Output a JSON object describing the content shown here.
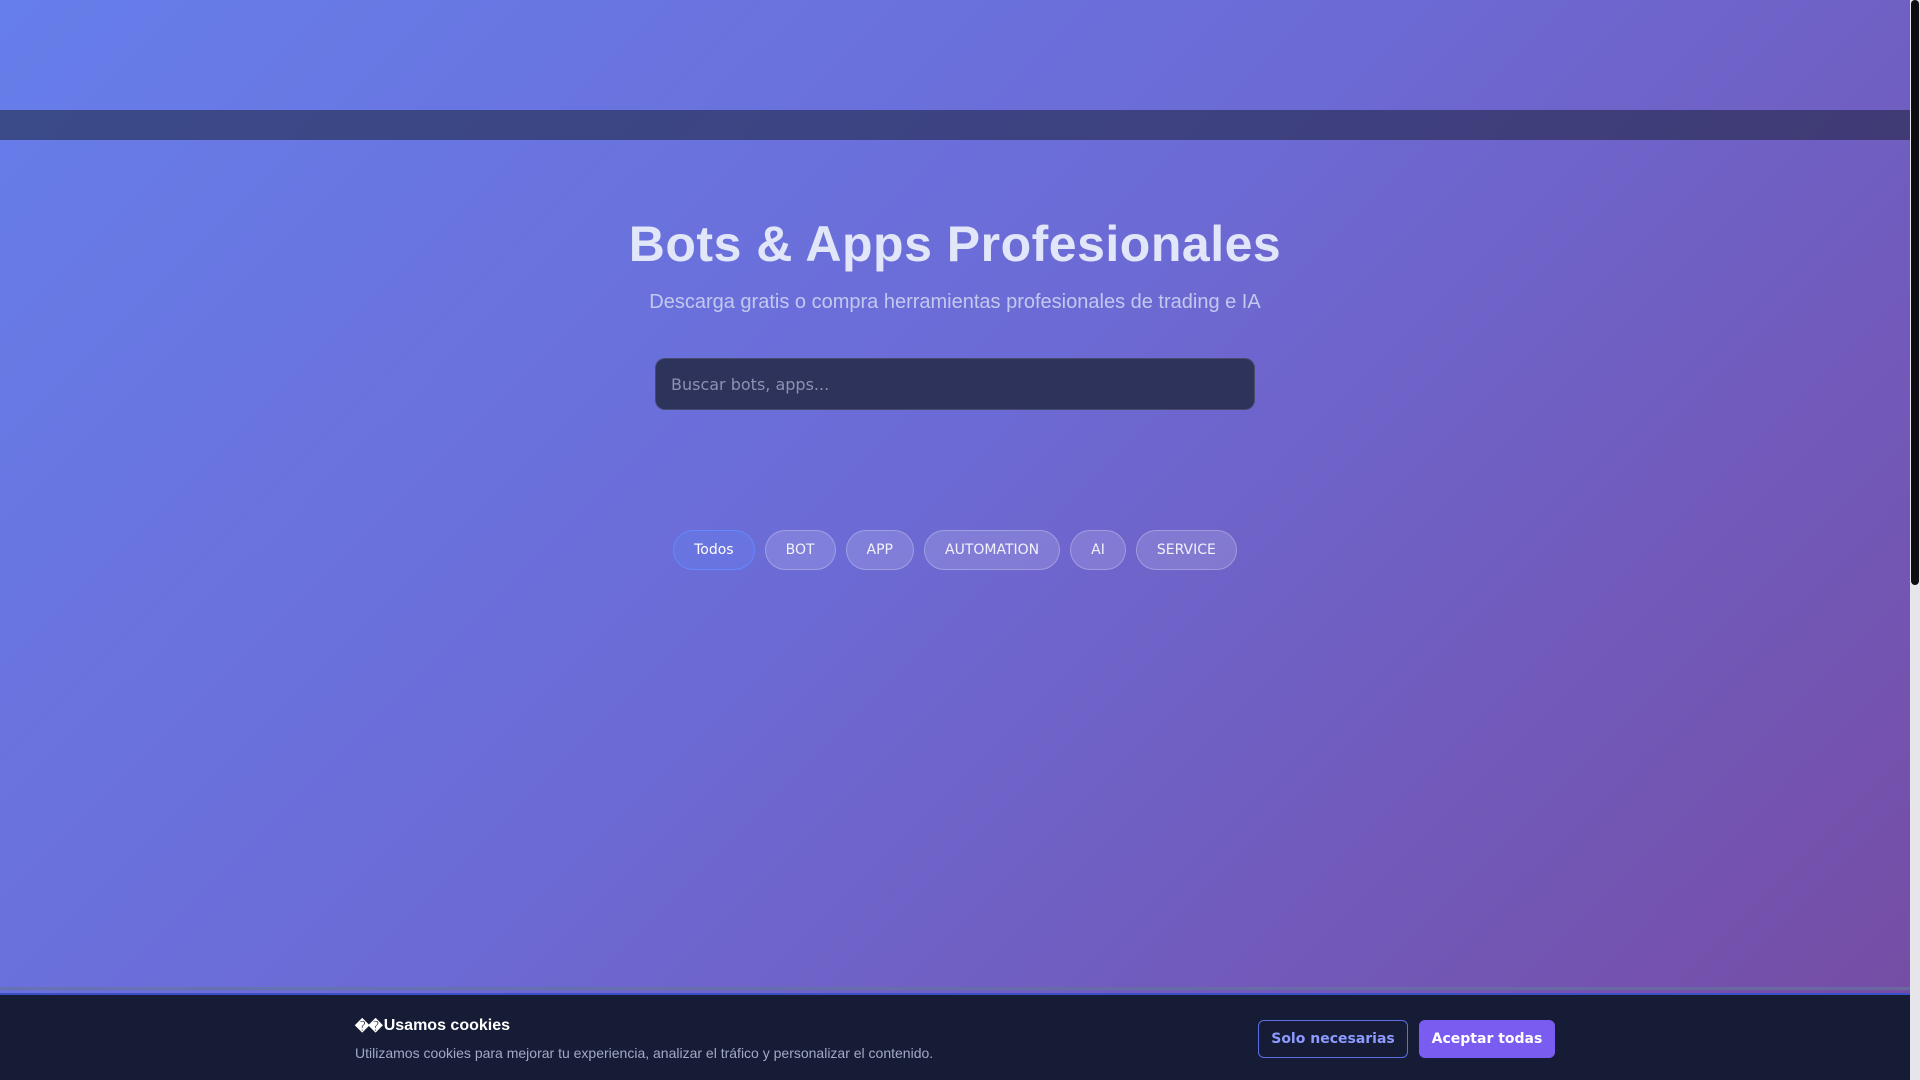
{
  "hero": {
    "title": "Bots & Apps Profesionales",
    "subtitle": "Descarga gratis o compra herramientas profesionales de trading e IA"
  },
  "search": {
    "placeholder": "Buscar bots, apps...",
    "value": ""
  },
  "filters": [
    {
      "label": "Todos",
      "active": true
    },
    {
      "label": "BOT",
      "active": false
    },
    {
      "label": "APP",
      "active": false
    },
    {
      "label": "AUTOMATION",
      "active": false
    },
    {
      "label": "AI",
      "active": false
    },
    {
      "label": "SERVICE",
      "active": false
    }
  ],
  "cookie_banner": {
    "icon_glyph": "��",
    "title": "Usamos cookies",
    "description": "Utilizamos cookies para mejorar tu experiencia, analizar el tráfico y personalizar el contenido.",
    "necessary_label": "Solo necesarias",
    "accept_label": "Aceptar todas"
  },
  "colors": {
    "background_start": "#667eea",
    "background_end": "#764ba2",
    "search_bg": "#2d335a",
    "banner_bg": "#161c35",
    "accept_button": "#7b5cf0",
    "active_chip_border": "#638cff"
  }
}
